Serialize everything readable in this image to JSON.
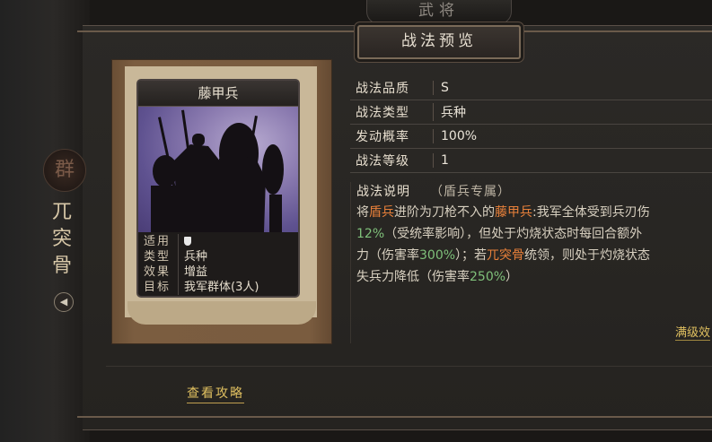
{
  "header": {
    "top_tab": "武将",
    "title": "战法预览"
  },
  "side": {
    "emblem": "群",
    "general_name": "兀突骨",
    "sound_icon": "speaker-icon"
  },
  "card": {
    "name": "藤甲兵",
    "rows": [
      {
        "key": "适用",
        "value": ""
      },
      {
        "key": "类型",
        "value": "兵种"
      },
      {
        "key": "效果",
        "value": "增益"
      },
      {
        "key": "目标",
        "value": "我军群体(3人)"
      }
    ]
  },
  "stats": [
    {
      "key": "战法品质",
      "value": "S"
    },
    {
      "key": "战法类型",
      "value": "兵种"
    },
    {
      "key": "发动概率",
      "value": "100%"
    },
    {
      "key": "战法等级",
      "value": "1"
    }
  ],
  "description": {
    "label": "战法说明",
    "note": "（盾兵专属）",
    "lines": [
      [
        {
          "t": "将"
        },
        {
          "t": "盾兵",
          "c": "orange"
        },
        {
          "t": "进阶为刀枪不入的"
        },
        {
          "t": "藤甲兵",
          "c": "orange"
        },
        {
          "t": ":我军全体受到兵刃伤"
        }
      ],
      [
        {
          "t": "12%",
          "c": "green"
        },
        {
          "t": "（受统率影响），但处于灼烧状态时每回合额外"
        }
      ],
      [
        {
          "t": "力（伤害率"
        },
        {
          "t": "300%",
          "c": "green"
        },
        {
          "t": "）；若"
        },
        {
          "t": "兀突骨",
          "c": "orange"
        },
        {
          "t": "统领，则处于灼烧状态"
        }
      ],
      [
        {
          "t": "失兵力降低（伤害率"
        },
        {
          "t": "250%",
          "c": "green"
        },
        {
          "t": "）"
        }
      ]
    ]
  },
  "links": {
    "full_level": "满级效",
    "view_guide": "查看攻略"
  },
  "colors": {
    "highlight_orange": "#e8803a",
    "highlight_green": "#7fc07a",
    "link_gold": "#e0c060"
  }
}
